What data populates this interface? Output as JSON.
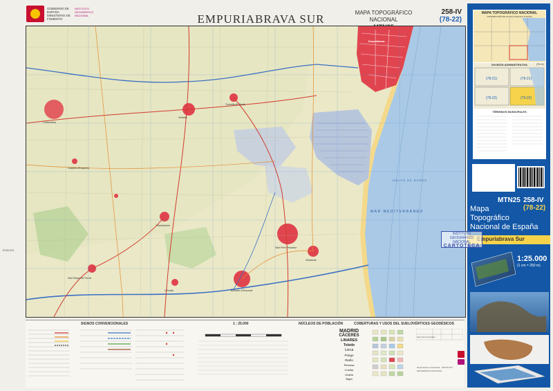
{
  "header": {
    "title": "EMPURIABRAVA SUR",
    "series_name": "MAPA TOPOGRÁFICO NACIONAL",
    "series_code": "MTN25",
    "sheet_number": "258-IV",
    "sheet_grid": "(78-22)",
    "logo_text_1": "GOBIERNO DE ESPAÑA",
    "logo_text_2": "MINISTERIO DE FOMENTO",
    "logo_text_3": "INSTITUTO GEOGRÁFICO NACIONAL"
  },
  "map": {
    "sea_label": "MAR MEDITERRÁNEO",
    "gulf_label": "GOLFO DE ROSES",
    "places": [
      {
        "name": "Sant Pere Pescador"
      },
      {
        "name": "Castelló d'Empúries"
      },
      {
        "name": "L'Escala"
      },
      {
        "name": "Torroella de Fluvià"
      },
      {
        "name": "Viladamat"
      },
      {
        "name": "Bellcaire d'Empordà"
      },
      {
        "name": "Sant Miquel de Fluvià"
      },
      {
        "name": "Vilamacolum"
      },
      {
        "name": "L'Armentera"
      },
      {
        "name": "Ventalló"
      },
      {
        "name": "Empuriabrava"
      }
    ],
    "left_margin_code": "ED50-ES1"
  },
  "legend": {
    "signs_title": "SIGNOS CONVENCIONALES",
    "scale_title": "1 : 25.000",
    "population_title": "NÚCLEOS DE POBLACIÓN",
    "landcover_title": "COBERTURAS Y USOS DEL SUELO",
    "vertices_title": "VÉRTICES GEODÉSICOS",
    "population_examples": [
      "MADRID",
      "CÁCERES",
      "LINARES",
      "Toledo",
      "Lorca",
      "Priego",
      "Riaño",
      "Reinosa",
      "Cuéllar",
      "Ocaña",
      "Sitges"
    ],
    "vertices_example": "Sant Pere Pescador",
    "footer_note": "Reproducción autorizada · INSTITUTO GEOGRÁFICO NACIONAL"
  },
  "side": {
    "sheet_map_title": "MAPA TOPOGRÁFICO NACIONAL",
    "sheet_map_sub": "DISTRIBUCIÓN DE HOJAS A ESCALA 1:50.000",
    "admin_title": "DIVISIÓN ADMINISTRATIVA",
    "admin_code": "(78-11)",
    "munis_title": "TÉRMINOS MUNICIPALES",
    "admin_cells": [
      "(78-21)",
      "(79-21)",
      "(78-22)",
      "(79-22)"
    ],
    "cover_code": "MTN25",
    "cover_sheet": "258-IV",
    "cover_grid": "(78-22)",
    "cover_title_line1": "Mapa",
    "cover_title_line2": "Topográfico",
    "cover_title_line3": "Nacional de España",
    "cover_sheet_name": "Empuriabrava Sur",
    "cover_scale": "1:25.000",
    "cover_scale_sub": "(1 cm = 250 m)",
    "stamp_line1": "INSTITUTO GEOGRÁFICO",
    "stamp_line2": "NACIONAL",
    "stamp_line3": "CARTOTECA"
  },
  "colors": {
    "sea": "#a9c9e6",
    "urban": "#e0454f",
    "land": "#eae8c7",
    "wetland": "#b8c6dc",
    "side_blue": "#1357a6",
    "band_yellow": "#f6d34a"
  }
}
